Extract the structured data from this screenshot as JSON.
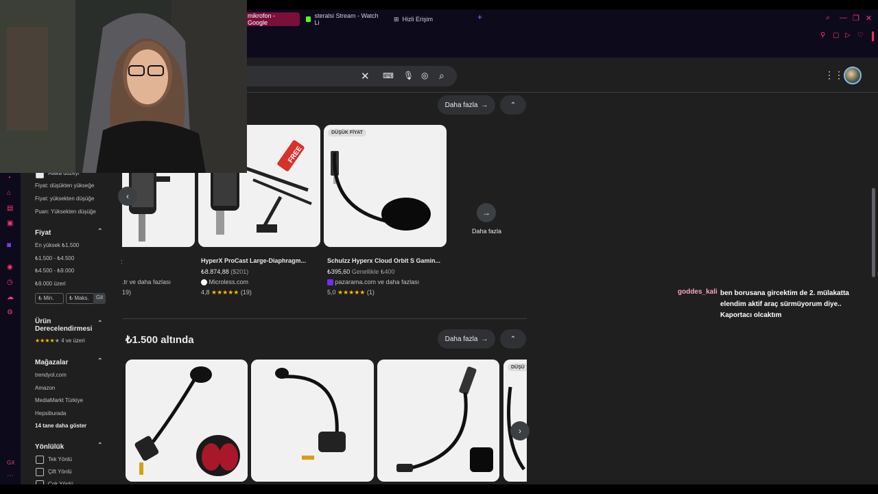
{
  "tabs": [
    {
      "label": "mikrofon - Google"
    },
    {
      "label": "steralsi Stream - Watch Li"
    },
    {
      "label": "Hizli Erişim"
    }
  ],
  "results_top": {
    "more_label": "Daha fazla",
    "products": [
      {
        "title": "",
        "store": ".tr ve daha fazlası",
        "rating": "19)"
      },
      {
        "title": "HyperX ProCast Large-Diaphragm...",
        "price": "₺8.874,88",
        "price_sub": "($201)",
        "store": "Microless.com",
        "rating_value": "4,8",
        "rating_count": "(19)",
        "badge": "FREE"
      },
      {
        "title": "Schulzz Hyperx Cloud Orbit S Gamin...",
        "price": "₺395,60",
        "price_sub": "Genellikle ₺400",
        "store": "pazarama.com ve daha fazlası",
        "rating_value": "5,0",
        "rating_count": "(1)",
        "badge": "DÜŞÜK FİYAT"
      }
    ],
    "more_card_label": "Daha fazla"
  },
  "section2": {
    "heading": "₺1.500 altında",
    "more_label": "Daha fazla",
    "badge": "DÜŞÜ"
  },
  "filters": {
    "sort_selected": "Alaka düzeyi",
    "sort_options": [
      "Fiyat: düşükten yükseğe",
      "Fiyat: yüksekten düşüğe",
      "Puan: Yüksekten düşüğe"
    ],
    "price_heading": "Fiyat",
    "price_options": [
      "En yüksek ₺1.500",
      "₺1.500 - ₺4.500",
      "₺4.500 - ₺9.000",
      "₺9.000 üzeri"
    ],
    "price_min": "₺ Min.",
    "price_max": "₺ Maks.",
    "price_go": "Git",
    "rating_heading": "Ürün Derecelendirmesi",
    "rating_option": "4 ve üzeri",
    "stores_heading": "Mağazalar",
    "stores": [
      "trendyol.com",
      "Amazon",
      "MediaMarkt Türkiye",
      "Hepsiburada"
    ],
    "stores_more": "14 tane daha göster",
    "direction_heading": "Yönlülük",
    "direction_options": [
      "Tek Yönlü",
      "Çift Yönlü",
      "Çok Yönlü"
    ]
  },
  "chat": {
    "username": "goddes_kali",
    "message": "ben borusana gircektim de 2. mülakatta elendim aktif araç sürmüyorum diye.. Kaportacı olcaktım"
  },
  "colors": {
    "accent": "#ff3a6e",
    "twitch": "#9146ff",
    "kick": "#53fc18",
    "star": "#fbbc04"
  }
}
